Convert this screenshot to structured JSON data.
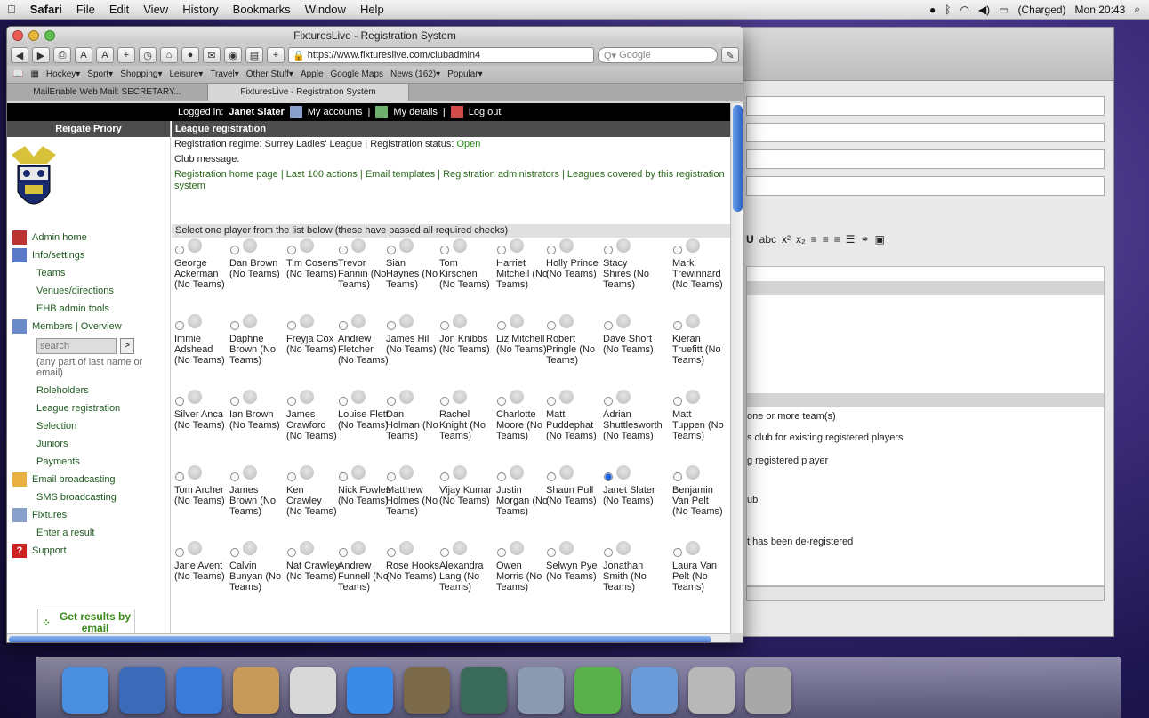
{
  "menubar": {
    "app": "Safari",
    "items": [
      "File",
      "Edit",
      "View",
      "History",
      "Bookmarks",
      "Window",
      "Help"
    ],
    "battery": "(Charged)",
    "clock": "Mon 20:43"
  },
  "window": {
    "title": "FixturesLive - Registration System",
    "url": "https://www.fixtureslive.com/clubadmin4",
    "search_placeholder": "Google",
    "bookmarks": [
      "Hockey▾",
      "Sport▾",
      "Shopping▾",
      "Leisure▾",
      "Travel▾",
      "Other Stuff▾",
      "Apple",
      "Google Maps",
      "News (162)▾",
      "Popular▾"
    ],
    "tabs": [
      "MailEnable Web Mail: SECRETARY...",
      "FixturesLive - Registration System"
    ]
  },
  "login": {
    "prefix": "Logged in:",
    "user": "Janet Slater",
    "accounts": "My accounts",
    "details": "My details",
    "logout": "Log out",
    "sep": "|"
  },
  "sidebar": {
    "club": "Reigate Priory",
    "items": [
      {
        "label": "Admin home",
        "icon": "house-icon"
      },
      {
        "label": "Info/settings",
        "icon": "settings-icon"
      },
      {
        "label": "Teams"
      },
      {
        "label": "Venues/directions"
      },
      {
        "label": "EHB admin tools"
      },
      {
        "label": "Members | Overview",
        "icon": "members-icon"
      }
    ],
    "search": {
      "placeholder": "search",
      "go": ">",
      "hint": "(any part of last name or email)"
    },
    "items2": [
      {
        "label": "Roleholders"
      },
      {
        "label": "League registration"
      },
      {
        "label": "Selection"
      },
      {
        "label": "Juniors"
      },
      {
        "label": "Payments"
      },
      {
        "label": "Email broadcasting",
        "icon": "email-icon"
      },
      {
        "label": "SMS broadcasting"
      },
      {
        "label": "Fixtures",
        "icon": "fixtures-icon"
      },
      {
        "label": "Enter a result"
      },
      {
        "label": "Support",
        "icon": "help-icon"
      }
    ],
    "promo": "Get results by email"
  },
  "main": {
    "header": "League registration",
    "regime_label": "Registration regime:",
    "regime": "Surrey Ladies' League",
    "status_label": "Registration status:",
    "status": "Open",
    "club_message": "Club message:",
    "links": "Registration home page | Last 100 actions | Email templates | Registration administrators | Leagues covered by this registration system",
    "select_header": "Select one player from the list below (these have passed all required checks)",
    "players": [
      [
        "George Ackerman (No Teams)",
        "Dan Brown (No Teams)",
        "Tim Cosens (No Teams)",
        "Trevor Fannin (No Teams)",
        "Sian Haynes (No Teams)",
        "Tom Kirschen (No Teams)",
        "Harriet Mitchell (No Teams)",
        "Holly Prince (No Teams)",
        "Stacy Shires (No Teams)",
        "Mark Trewinnard (No Teams)"
      ],
      [
        "Immie Adshead (No Teams)",
        "Daphne Brown (No Teams)",
        "Freyja Cox (No Teams)",
        "Andrew Fletcher (No Teams)",
        "James Hill (No Teams)",
        "Jon Knibbs (No Teams)",
        "Liz Mitchell (No Teams)",
        "Robert Pringle (No Teams)",
        "Dave Short (No Teams)",
        "Kieran Truefitt (No Teams)"
      ],
      [
        "Silver Anca (No Teams)",
        "Ian Brown (No Teams)",
        "James Crawford (No Teams)",
        "Louise Flett (No Teams)",
        "Dan Holman (No Teams)",
        "Rachel Knight (No Teams)",
        "Charlotte Moore (No Teams)",
        "Matt Puddephat (No Teams)",
        "Adrian Shuttlesworth (No Teams)",
        "Matt Tuppen (No Teams)"
      ],
      [
        "Tom Archer (No Teams)",
        "James Brown (No Teams)",
        "Ken Crawley (No Teams)",
        "Nick Fowles (No Teams)",
        "Matthew Holmes (No Teams)",
        "Vijay Kumar (No Teams)",
        "Justin Morgan (No Teams)",
        "Shaun Pull (No Teams)",
        "Janet Slater (No Teams)",
        "Benjamin Van Pelt (No Teams)"
      ],
      [
        "Jane Avent (No Teams)",
        "Calvin Bunyan (No Teams)",
        "Nat Crawley (No Teams)",
        "Andrew Funnell (No Teams)",
        "Rose Hooks (No Teams)",
        "Alexandra Lang (No Teams)",
        "Owen Morris (No Teams)",
        "Selwyn Pye (No Teams)",
        "Jonathan Smith (No Teams)",
        "Laura Van Pelt (No Teams)"
      ]
    ],
    "selected_player": "Janet Slater (No Teams)"
  },
  "backwin": {
    "options": [
      "one or more team(s)",
      "s club for existing registered players",
      "g registered player",
      "ub",
      "t has been de-registered"
    ]
  },
  "dock": [
    "finder-icon",
    "mail-icon",
    "safari-icon",
    "addressbook-icon",
    "ical-icon",
    "itunes-icon",
    "iphoto-icon",
    "timemachine-icon",
    "printer-icon",
    "evernote-icon",
    "applications-icon",
    "documents-icon",
    "trash-icon"
  ]
}
